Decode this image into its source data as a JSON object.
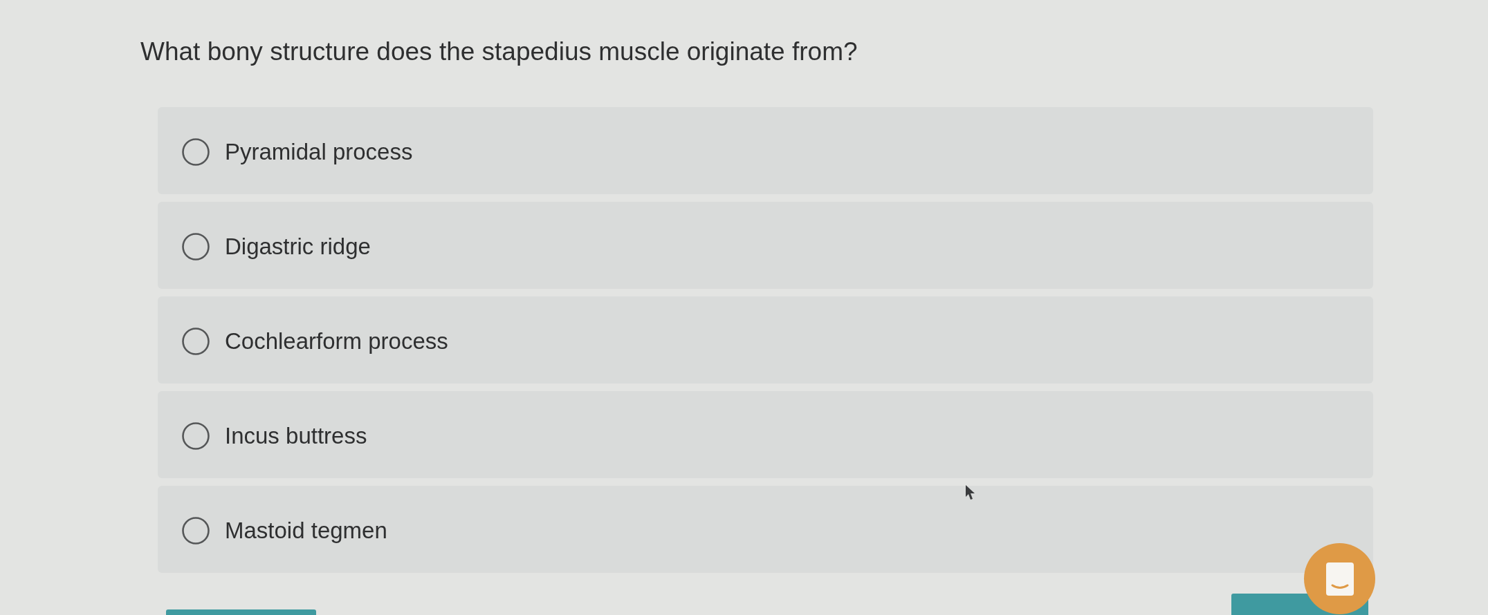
{
  "question": {
    "text": "What bony structure does the stapedius muscle originate from?"
  },
  "options": [
    {
      "label": "Pyramidal process",
      "selected": false
    },
    {
      "label": "Digastric ridge",
      "selected": false
    },
    {
      "label": "Cochlearform process",
      "selected": false
    },
    {
      "label": "Incus buttress",
      "selected": false
    },
    {
      "label": "Mastoid tegmen",
      "selected": false
    }
  ]
}
